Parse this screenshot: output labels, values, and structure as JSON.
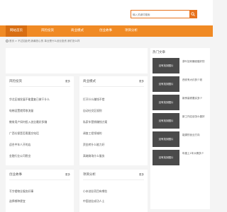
{
  "search": {
    "placeholder": "输入关键词搜索"
  },
  "nav": {
    "items": [
      {
        "label": "网站首页"
      },
      {
        "label": "风险投资"
      },
      {
        "label": "商业模式"
      },
      {
        "label": "创业故事"
      },
      {
        "label": "项目分析"
      }
    ]
  },
  "breadcrumb": "首页 > 不过如此吧,我最担心的 事业是什么创业投资 我们怎么样",
  "panels": {
    "fengxian": {
      "title": "风险投资",
      "more": "更多",
      "items": [
        "华北区域发展不能重复已做干什么",
        "电梯设置就得收流量",
        "教育用户如何投入创业最好多赚",
        "广西社保是否需要交电话",
        "适合中年人开的店",
        "金融行业公司税业"
      ]
    },
    "shangye": {
      "title": "商业模式",
      "more": "更多",
      "items": [
        "打开什么赚钱不错",
        "自动社交区规则",
        "私家车营销赚钱方案",
        "调查工程领域的",
        "资金转什么能力好",
        "高端商场什么服务"
      ]
    },
    "chuangye": {
      "title": "创业故事",
      "more": "更多",
      "items": [
        "写字楼物业服务好事",
        "选择哪种便宜"
      ]
    },
    "xiangmu": {
      "title": "项目分析",
      "more": "更多",
      "items": [
        "小本创业项目有哪些",
        "中国创业成功人士"
      ]
    }
  },
  "sidebar": {
    "title": "热门文章",
    "items": [
      {
        "thumb": "没有找到图片",
        "text": "茶叶如何赚钱做好的"
      },
      {
        "thumb": "没有找到图片",
        "text": "西安有大约多少钱"
      },
      {
        "thumb": "没有找到图片",
        "text": "新房装修要买多少"
      },
      {
        "thumb": "没有找到图片",
        "text": "新工作应该怎么做好"
      },
      {
        "thumb": "没有找到图片",
        "text": "能源的创业方向"
      },
      {
        "thumb": "没有找到图片",
        "text": "年度上1年大概多少"
      }
    ]
  },
  "colors": {
    "accent": "#f08a24",
    "accent_dark": "#d86e12"
  },
  "icons": {
    "search": "search-icon",
    "home": "home-icon"
  }
}
